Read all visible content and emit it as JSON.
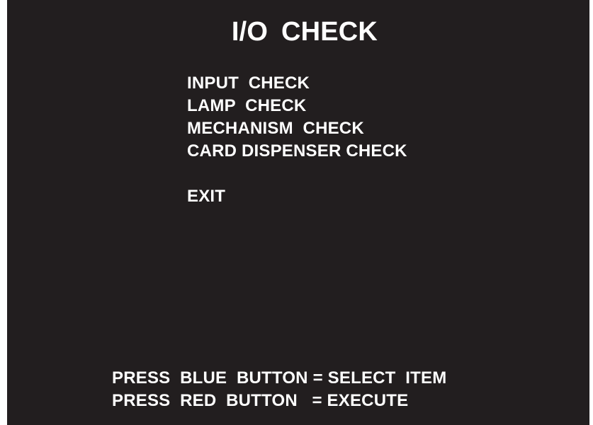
{
  "screen": {
    "title": "I/O  CHECK",
    "background_color": "#221e1f",
    "text_color": "#ffffff"
  },
  "menu": {
    "items": [
      {
        "label": "INPUT  CHECK"
      },
      {
        "label": "LAMP  CHECK"
      },
      {
        "label": "MECHANISM  CHECK"
      },
      {
        "label": "CARD DISPENSER CHECK"
      },
      {
        "label": "EXIT"
      }
    ]
  },
  "instructions": {
    "select_line": "PRESS  BLUE  BUTTON = SELECT  ITEM",
    "execute_line": "PRESS  RED  BUTTON   = EXECUTE"
  }
}
